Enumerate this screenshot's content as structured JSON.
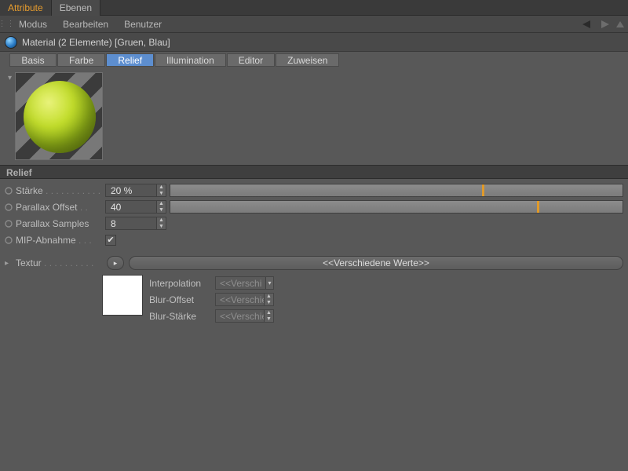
{
  "panelTabs": [
    {
      "label": "Attribute",
      "active": true
    },
    {
      "label": "Ebenen",
      "active": false
    }
  ],
  "menu": {
    "modus": "Modus",
    "bearbeiten": "Bearbeiten",
    "benutzer": "Benutzer"
  },
  "object": {
    "title": "Material (2 Elemente) [Gruen, Blau]"
  },
  "materialTabs": [
    {
      "label": "Basis"
    },
    {
      "label": "Farbe"
    },
    {
      "label": "Relief",
      "active": true
    },
    {
      "label": "Illumination"
    },
    {
      "label": "Editor"
    },
    {
      "label": "Zuweisen"
    }
  ],
  "section": "Relief",
  "params": {
    "staerke": {
      "label": "Stärke",
      "value": "20 %",
      "markPct": 69
    },
    "parallaxOffset": {
      "label": "Parallax Offset",
      "value": "40",
      "markPct": 81
    },
    "parallaxSamples": {
      "label": "Parallax Samples",
      "value": "8"
    },
    "mipAbnahme": {
      "label": "MIP-Abnahme",
      "checked": true
    }
  },
  "textur": {
    "label": "Textur",
    "value": "<<Verschiedene Werte>>",
    "interp": {
      "label": "Interpolation",
      "value": "<<Verschi"
    },
    "blurOffset": {
      "label": "Blur-Offset",
      "value": "<<Verschie"
    },
    "blurStaerke": {
      "label": "Blur-Stärke",
      "value": "<<Verschie"
    }
  }
}
